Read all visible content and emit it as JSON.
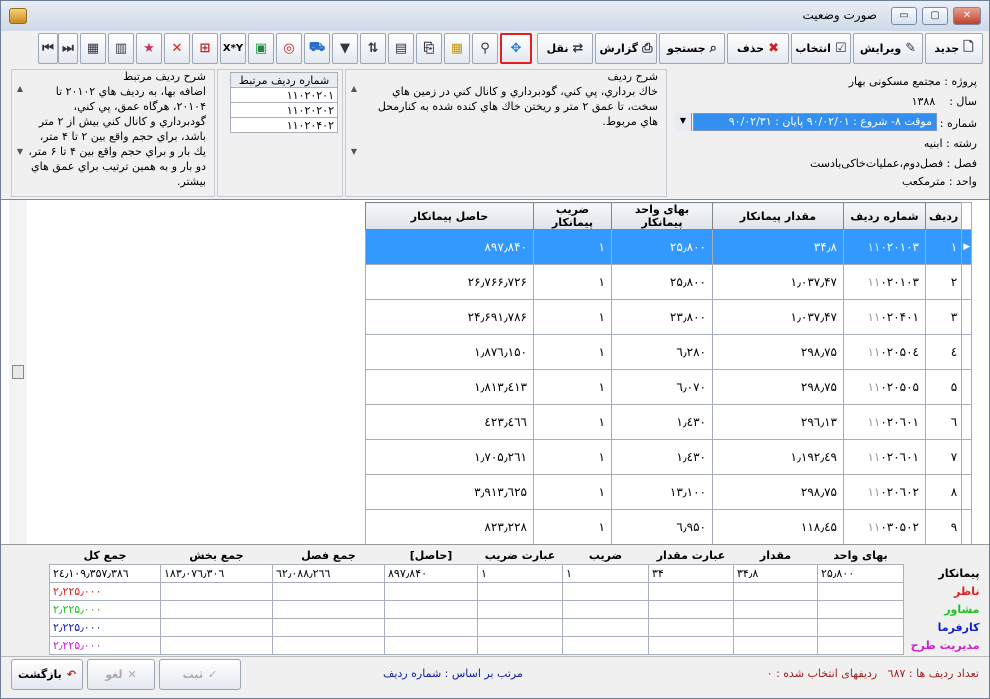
{
  "window": {
    "title": "صورت وضعیت",
    "buttons": {
      "minimize": "▭",
      "maximize": "▢",
      "close": "✕"
    }
  },
  "toolbar": {
    "new": "جدید",
    "edit": "ویرایش",
    "select": "انتخاب",
    "delete": "حذف",
    "search": "جستجو",
    "report": "گزارش",
    "transfer": "نقل",
    "formula": "X*Y"
  },
  "form": {
    "project_label": "پروژه :",
    "project": "مجتمع مسکونی بهار",
    "year_label": "سال :",
    "year": "۱۳۸۸",
    "number_label": "شماره :",
    "number": "موقت ۸- شروع : ۹۰/۰۲/۰۱ پایان : ۹۰/۰۲/۳۱",
    "field_label": "رشته :",
    "field": "ابنیه",
    "chapter_label": "فصل :",
    "chapter": "فصل‌دوم،عملیات‌خاکی‌بادست",
    "unit_label": "واحد :",
    "unit": "مترمکعب"
  },
  "row_desc": {
    "label": "شرح ردیف",
    "text": "خاك برداري، پي كني، گودبرداري و كانال كني در زمين هاي سخت، تا عمق ۲ متر و ريختن خاك هاي كنده شده به كنارمحل هاي مربوط."
  },
  "related": {
    "header": "شماره ردیف مرتبط",
    "rows": [
      "۱۱۰۲۰۲۰۱",
      "۱۱۰۲۰۲۰۲",
      "۱۱۰۲۰۴۰۲"
    ]
  },
  "related_desc": {
    "label": "شرح ردیف مرتبط",
    "text": "اضافه بها، به رديف هاي ۲۰۱۰۲ تا ۲۰۱۰۴، هرگاه عمق، پي كني، گودبرداري و كانال كني بيش از ۲ متر باشد، براي حجم واقع بين ۲ تا ۴ متر، يك بار و براي حجم واقع بين ۴ تا ۶ متر، دو بار و به همين ترتيب براي عمق هاي بيشتر."
  },
  "grid": {
    "headers": [
      "ردیف",
      "شماره ردیف",
      "مقدار پیمانکار",
      "بهای واحد پیمانکار",
      "ضریب پیمانکار",
      "حاصل پیمانکار"
    ],
    "rows": [
      {
        "n": "۱",
        "pre": "۱۱",
        "id": "۰۲۰۱۰۳",
        "qty": "۳۴٫۸",
        "unit_price": "۲۵٫۸۰۰",
        "coef": "۱",
        "total": "۸۹۷٫۸۴۰"
      },
      {
        "n": "۲",
        "pre": "۱۱",
        "id": "۰۲۰۱۰۳",
        "qty": "۱٫۰۳۷٫۴۷",
        "unit_price": "۲۵٫۸۰۰",
        "coef": "۱",
        "total": "۲۶٫۷۶۶٫۷۲۶"
      },
      {
        "n": "۳",
        "pre": "۱۱",
        "id": "۰۲۰۴۰۱",
        "qty": "۱٫۰۳۷٫۴۷",
        "unit_price": "۲۳٫۸۰۰",
        "coef": "۱",
        "total": "۲۴٫۶۹۱٫۷۸۶"
      },
      {
        "n": "٤",
        "pre": "۱۱",
        "id": "۰۲۰۵۰٤",
        "qty": "۲۹۸٫۷۵",
        "unit_price": "٦٫۲۸۰",
        "coef": "۱",
        "total": "۱٫۸۷٦٫۱۵۰"
      },
      {
        "n": "۵",
        "pre": "۱۱",
        "id": "۰۲۰۵۰۵",
        "qty": "۲۹۸٫۷۵",
        "unit_price": "٦٫۰۷۰",
        "coef": "۱",
        "total": "۱٫۸۱۳٫٤۱۳"
      },
      {
        "n": "٦",
        "pre": "۱۱",
        "id": "۰۲۰٦۰۱",
        "qty": "۲۹٦٫۱۳",
        "unit_price": "۱٫٤۳۰",
        "coef": "۱",
        "total": "٤۲۳٫٤٦٦"
      },
      {
        "n": "۷",
        "pre": "۱۱",
        "id": "۰۲۰٦۰۱",
        "qty": "۱٫۱۹۲٫٤۹",
        "unit_price": "۱٫٤۳۰",
        "coef": "۱",
        "total": "۱٫۷۰۵٫۲٦۱"
      },
      {
        "n": "۸",
        "pre": "۱۱",
        "id": "۰۲۰٦۰۲",
        "qty": "۲۹۸٫۷۵",
        "unit_price": "۱۳٫۱۰۰",
        "coef": "۱",
        "total": "۳٫۹۱۳٫٦۲۵"
      },
      {
        "n": "۹",
        "pre": "۱۱",
        "id": "۰۳۰۵۰۲",
        "qty": "۱۱۸٫٤۵",
        "unit_price": "٦٫۹۵۰",
        "coef": "۱",
        "total": "۸۲۳٫۲۲۸"
      }
    ]
  },
  "summary": {
    "headers": [
      "بهای واحد",
      "مقدار",
      "عبارت مقدار",
      "ضریب",
      "عبارت ضریب",
      "[حاصل]",
      "جمع فصل",
      "جمع بخش",
      "جمع کل"
    ],
    "rows": [
      {
        "label": "پیمانکار",
        "color": "#000000",
        "cells": [
          "۲۵٫۸۰۰",
          "۳۴٫۸",
          "۳۴",
          "۱",
          "۱",
          "۸۹۷٫۸۴۰",
          "٦۲٫۰۸۸٫۲٦٦",
          "۱۸۳٫۰۷٦٫۳۰٦",
          "۲٤٫۱۰۹٫۳۵۷٫۳۸٦"
        ]
      },
      {
        "label": "ناظر",
        "color": "#e02020",
        "cells": [
          "",
          "",
          "",
          "",
          "",
          "",
          "",
          "",
          "۲٫۲۲۵٫۰۰۰"
        ]
      },
      {
        "label": "مشاور",
        "color": "#20c020",
        "cells": [
          "",
          "",
          "",
          "",
          "",
          "",
          "",
          "",
          "۲٫۲۲۵٫۰۰۰"
        ]
      },
      {
        "label": "کارفرما",
        "color": "#1020c0",
        "cells": [
          "",
          "",
          "",
          "",
          "",
          "",
          "",
          "",
          "۲٫۲۲۵٫۰۰۰"
        ]
      },
      {
        "label": "مدیریت طرح",
        "color": "#d020d0",
        "cells": [
          "",
          "",
          "",
          "",
          "",
          "",
          "",
          "",
          "۲٫۲۲۵٫۰۰۰"
        ]
      }
    ]
  },
  "footer": {
    "back": "بازگشت",
    "cancel": "لغو",
    "save": "ثبت",
    "sorted_by": "مرتب بر اساس : شماره ردیف",
    "row_count": "تعداد ردیف ها : ٦۸۷",
    "selected_count": "ردیفهای انتخاب شده : ۰"
  }
}
